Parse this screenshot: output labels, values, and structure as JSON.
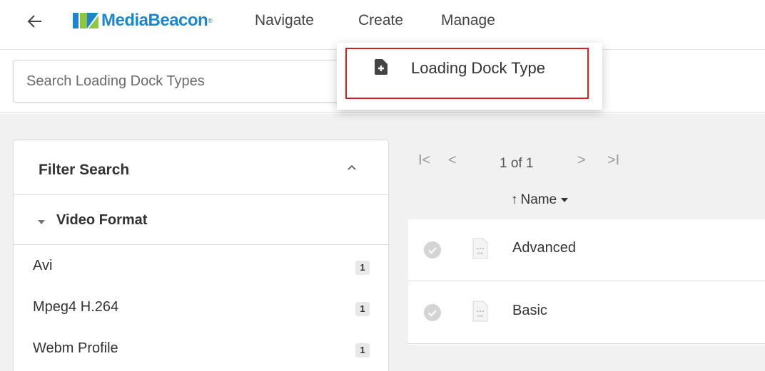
{
  "nav": {
    "back_icon": "arrow-left-icon",
    "logo_text": "MediaBeacon",
    "logo_mark": "®",
    "items": [
      "Navigate",
      "Create",
      "Manage"
    ]
  },
  "search": {
    "placeholder": "Search Loading Dock Types",
    "value": ""
  },
  "create_menu": {
    "items": [
      {
        "label": "Loading Dock Type",
        "icon": "file-plus-icon",
        "highlighted": true
      }
    ]
  },
  "filter": {
    "title": "Filter Search",
    "groups": [
      {
        "title": "Video Format",
        "items": [
          {
            "label": "Avi",
            "count": "1"
          },
          {
            "label": "Mpeg4 H.264",
            "count": "1"
          },
          {
            "label": "Webm Profile",
            "count": "1"
          }
        ]
      }
    ]
  },
  "pager": {
    "text": "1 of 1",
    "first": "I<",
    "prev": "<",
    "next": ">",
    "last": ">I"
  },
  "sort": {
    "arrow": "↑",
    "label": "Name"
  },
  "results": [
    {
      "name": "Advanced",
      "file_type": "XMP"
    },
    {
      "name": "Basic",
      "file_type": "XMP"
    }
  ],
  "colors": {
    "brand_blue": "#1d86c8",
    "brand_green": "#8dc63f",
    "highlight_red": "#d0201d"
  }
}
